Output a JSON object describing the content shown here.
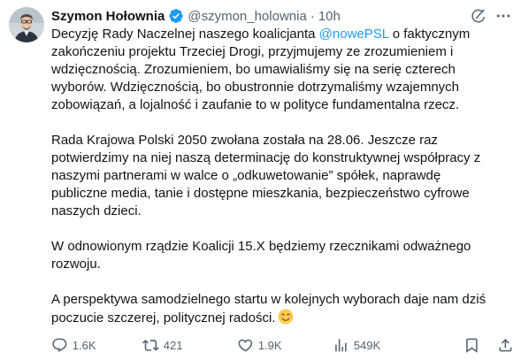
{
  "author": {
    "name": "Szymon Hołownia",
    "handle": "@szymon_holownia",
    "separator": "·",
    "time": "10h"
  },
  "icons": {
    "verified": "verified-badge-icon",
    "grok": "grok-icon",
    "more": "more-icon"
  },
  "colors": {
    "text": "#0f1419",
    "secondary": "#536471",
    "accent": "#1d9bf0"
  },
  "tweet": {
    "p1": {
      "l1_a": "Decyzję Rady Naczelnej naszego koalicjanta ",
      "l1_mention": "@nowePSL",
      "l1_b": " o faktycznym",
      "l2": "zakończeniu projektu Trzeciej Drogi, przyjmujemy ze zrozumieniem i",
      "l3": "wdzięcznością. Zrozumieniem, bo umawialiśmy się na serię czterech",
      "l4": "wyborów. Wdzięcznością, bo obustronnie dotrzymaliśmy wzajemnych",
      "l5": "zobowiązań, a lojalność i zaufanie to w polityce fundamentalna rzecz."
    },
    "p2": {
      "l1": "Rada Krajowa Polski 2050 zwołana została na 28.06.  Jeszcze raz",
      "l2": "potwierdzimy na niej naszą determinację do konstruktywnej współpracy z",
      "l3": "naszymi partnerami w walce o „odkuwetowanie” spółek, naprawdę",
      "l4": "publiczne media, tanie i dostępne mieszkania, bezpieczeństwo cyfrowe",
      "l5": "naszych dzieci."
    },
    "p3": {
      "l1": "W odnowionym rządzie Koalicji 15.X będziemy rzecznikami odważnego",
      "l2": "rozwoju."
    },
    "p4": {
      "l1": "A perspektywa samodzielnego startu w kolejnych wyborach daje nam dziś",
      "l2": "poczucie szczerej, politycznej radości."
    },
    "emoji": "smiling-face-emoji"
  },
  "actions": {
    "replies": "1.6K",
    "reposts": "421",
    "likes": "1.9K",
    "views": "549K"
  }
}
